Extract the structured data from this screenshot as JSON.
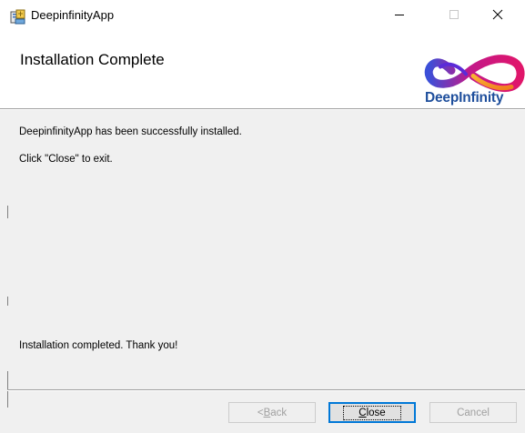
{
  "window": {
    "title": "DeepinfinityApp",
    "app_icon": "installer-icon",
    "controls": {
      "minimize_icon": "minimize-icon",
      "maximize_icon": "maximize-icon",
      "close_icon": "close-icon"
    }
  },
  "header": {
    "title": "Installation Complete",
    "logo_text": "DeepInfinity",
    "logo_icon": "infinity-logo-icon"
  },
  "content": {
    "success_message": "DeepinfinityApp has been successfully installed.",
    "exit_hint": "Click \"Close\" to exit.",
    "thank_you": "Installation completed. Thank you!"
  },
  "buttons": {
    "back": {
      "label": "Back",
      "prefix": "< ",
      "mnemonic": "B",
      "enabled": false
    },
    "close": {
      "label": "Close",
      "mnemonic": "C",
      "enabled": true,
      "default": true
    },
    "cancel": {
      "label": "Cancel",
      "enabled": false
    }
  },
  "colors": {
    "logo_text": "#1f4f9c",
    "default_button_border": "#0078d7",
    "dialog_background": "#f0f0f0"
  }
}
